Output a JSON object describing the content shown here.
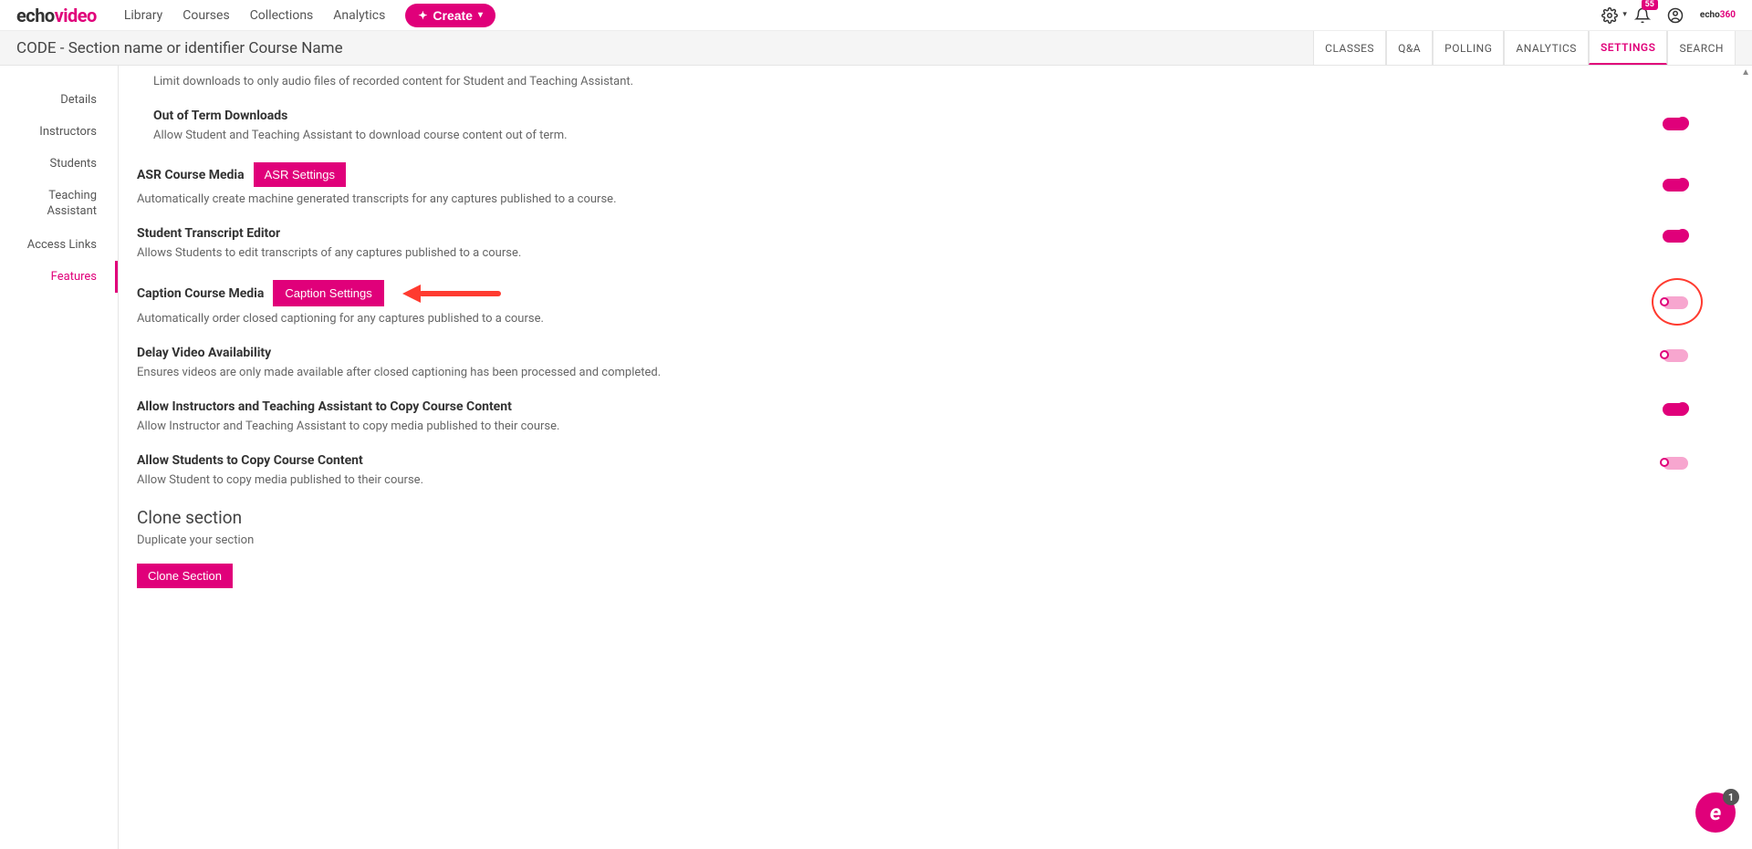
{
  "top_nav": {
    "logo_echo": "echo",
    "logo_video": "video",
    "links": [
      "Library",
      "Courses",
      "Collections",
      "Analytics"
    ],
    "create_label": "Create",
    "notif_count": "55",
    "brand_chip_echo": "echo",
    "brand_chip_accent": "360"
  },
  "course_header": {
    "title": "CODE - Section name or identifier Course Name",
    "tabs": [
      "CLASSES",
      "Q&A",
      "POLLING",
      "ANALYTICS",
      "SETTINGS",
      "SEARCH"
    ],
    "active_tab_index": 4
  },
  "sidebar": {
    "items": [
      "Details",
      "Instructors",
      "Students",
      "Teaching Assistant",
      "Access Links",
      "Features"
    ],
    "active_index": 5
  },
  "settings": {
    "limit_downloads_desc": "Limit downloads to only audio files of recorded content for Student and Teaching Assistant.",
    "out_of_term_title": "Out of Term Downloads",
    "out_of_term_desc": "Allow Student and Teaching Assistant to download course content out of term.",
    "asr_title": "ASR Course Media",
    "asr_badge": "ASR Settings",
    "asr_desc": "Automatically create machine generated transcripts for any captures published to a course.",
    "ste_title": "Student Transcript Editor",
    "ste_desc": "Allows Students to edit transcripts of any captures published to a course.",
    "caption_title": "Caption Course Media",
    "caption_badge": "Caption Settings",
    "caption_desc": "Automatically order closed captioning for any captures published to a course.",
    "delay_title": "Delay Video Availability",
    "delay_desc": "Ensures videos are only made available after closed captioning has been processed and completed.",
    "instructor_copy_title": "Allow Instructors and Teaching Assistant to Copy Course Content",
    "instructor_copy_desc": "Allow Instructor and Teaching Assistant to copy media published to their course.",
    "student_copy_title": "Allow Students to Copy Course Content",
    "student_copy_desc": "Allow Student to copy media published to their course.",
    "clone_h": "Clone section",
    "clone_desc": "Duplicate your section",
    "clone_btn": "Clone Section"
  },
  "chat": {
    "badge": "1",
    "letter": "e"
  }
}
